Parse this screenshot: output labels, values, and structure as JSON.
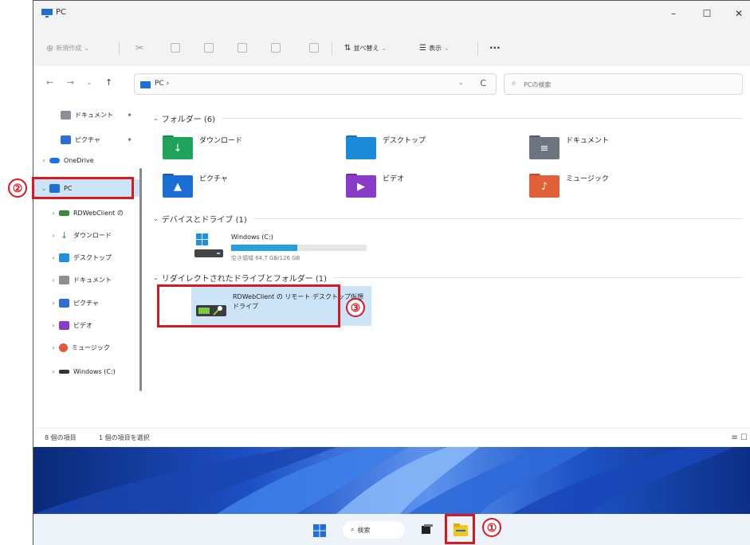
{
  "window": {
    "title": "PC",
    "minimize": "–",
    "maximize": "☐",
    "close": "✕"
  },
  "toolbar": {
    "new_label": "新規作成",
    "sort_label": "並べ替え",
    "view_label": "表示",
    "more_label": "···"
  },
  "address": {
    "breadcrumb": "PC ›",
    "dropdown": "⌄",
    "refresh": "C",
    "search_placeholder": "PCの検索"
  },
  "sidebar": {
    "items": [
      {
        "label": "ドキュメント",
        "pinned": true,
        "color": "#8a8f98"
      },
      {
        "label": "ピクチャ",
        "pinned": true,
        "color": "#2b6fd6"
      },
      {
        "label": "OneDrive",
        "chev": "›",
        "color": "#1a73e8"
      },
      {
        "label": "PC",
        "chev": "⌄",
        "color": "#1f6fd4",
        "selected": true
      },
      {
        "label": "RDWebClient の",
        "chev": "›",
        "color": "#3a8a3a"
      },
      {
        "label": "ダウンロード",
        "chev": "›",
        "color": "#24a148"
      },
      {
        "label": "デスクトップ",
        "chev": "›",
        "color": "#1f8fe0"
      },
      {
        "label": "ドキュメント",
        "chev": "›",
        "color": "#8a8f98"
      },
      {
        "label": "ピクチャ",
        "chev": "›",
        "color": "#2b6fd6"
      },
      {
        "label": "ビデオ",
        "chev": "›",
        "color": "#8a3cc8"
      },
      {
        "label": "ミュージック",
        "chev": "›",
        "color": "#e8583a"
      },
      {
        "label": "Windows (C:)",
        "chev": "›",
        "color": "#333333"
      }
    ]
  },
  "content": {
    "folders_header": "フォルダー (6)",
    "folders": [
      {
        "label": "ダウンロード",
        "color": "#1fa35b",
        "glyph": "↓"
      },
      {
        "label": "デスクトップ",
        "color": "#1b8ad8",
        "glyph": ""
      },
      {
        "label": "ドキュメント",
        "color": "#6d7480",
        "glyph": "≡"
      },
      {
        "label": "ピクチャ",
        "color": "#1b6fd4",
        "glyph": "▲"
      },
      {
        "label": "ビデオ",
        "color": "#8a3cc8",
        "glyph": "▶"
      },
      {
        "label": "ミュージック",
        "color": "#e0603a",
        "glyph": "♪"
      }
    ],
    "devices_header": "デバイスとドライブ (1)",
    "drive": {
      "name": "Windows (C:)",
      "free_text": "空き領域 64.7 GB/126 GB",
      "used_fraction": 0.49
    },
    "redirect_header": "リダイレクトされたドライブとフォルダー (1)",
    "redirect_item": "RDWebClient の リモート デスクトップ仮想ドライブ"
  },
  "status": {
    "count": "8 個の項目",
    "selected": "1 個の項目を選択"
  },
  "taskbar": {
    "search_label": "検索"
  },
  "callouts": [
    "①",
    "②",
    "③"
  ],
  "colors": {
    "accent": "#1f6fd4",
    "highlight": "#d71920",
    "selection": "#cce4f7"
  }
}
